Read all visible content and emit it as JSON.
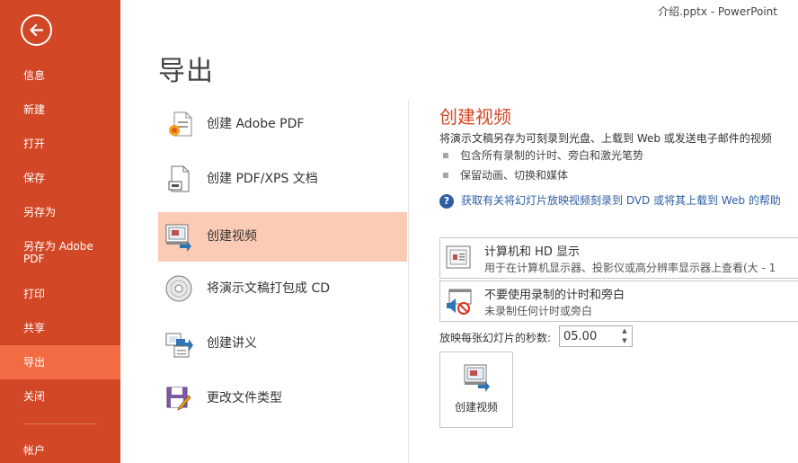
{
  "window": {
    "title": "介绍.pptx - PowerPoint"
  },
  "sidebar": {
    "back_icon": "back-arrow-icon",
    "items": [
      {
        "label": "信息"
      },
      {
        "label": "新建"
      },
      {
        "label": "打开"
      },
      {
        "label": "保存"
      },
      {
        "label": "另存为"
      },
      {
        "label": "另存为 Adobe\nPDF"
      },
      {
        "label": "打印"
      },
      {
        "label": "共享"
      },
      {
        "label": "导出",
        "active": true
      },
      {
        "label": "关闭"
      },
      {
        "label": "帐户"
      }
    ]
  },
  "main": {
    "title": "导出",
    "options": [
      {
        "label": "创建 Adobe PDF",
        "icon": "adobe-pdf-icon"
      },
      {
        "label": "创建 PDF/XPS 文档",
        "icon": "pdf-xps-document-icon"
      },
      {
        "label": "创建视频",
        "icon": "create-video-icon",
        "selected": true
      },
      {
        "label": "将演示文稿打包成 CD",
        "icon": "cd-disc-icon"
      },
      {
        "label": "创建讲义",
        "icon": "handouts-icon"
      },
      {
        "label": "更改文件类型",
        "icon": "change-file-type-icon"
      }
    ]
  },
  "detail": {
    "title": "创建视频",
    "description": "将演示文稿另存为可刻录到光盘、上载到 Web 或发送电子邮件的视频",
    "bullets": [
      "包含所有录制的计时、旁白和激光笔势",
      "保留动画、切换和媒体"
    ],
    "help_link": "获取有关将幻灯片放映视频刻录到 DVD 或将其上载到 Web 的帮助",
    "quality_dropdown": {
      "title": "计算机和 HD 显示",
      "subtitle": "用于在计算机显示器、投影仪或高分辨率显示器上查看(大 - 1"
    },
    "timing_dropdown": {
      "title": "不要使用录制的计时和旁白",
      "subtitle": "未录制任何计时或旁白"
    },
    "seconds_label": "放映每张幻灯片的秒数:",
    "seconds_value": "05.00",
    "create_button": "创建视频"
  },
  "colors": {
    "sidebar": "#d24726",
    "sidebar_active": "#f26b43",
    "selected_option": "#fbcbb5",
    "accent_title": "#d24726",
    "link": "#2e5ea3"
  }
}
